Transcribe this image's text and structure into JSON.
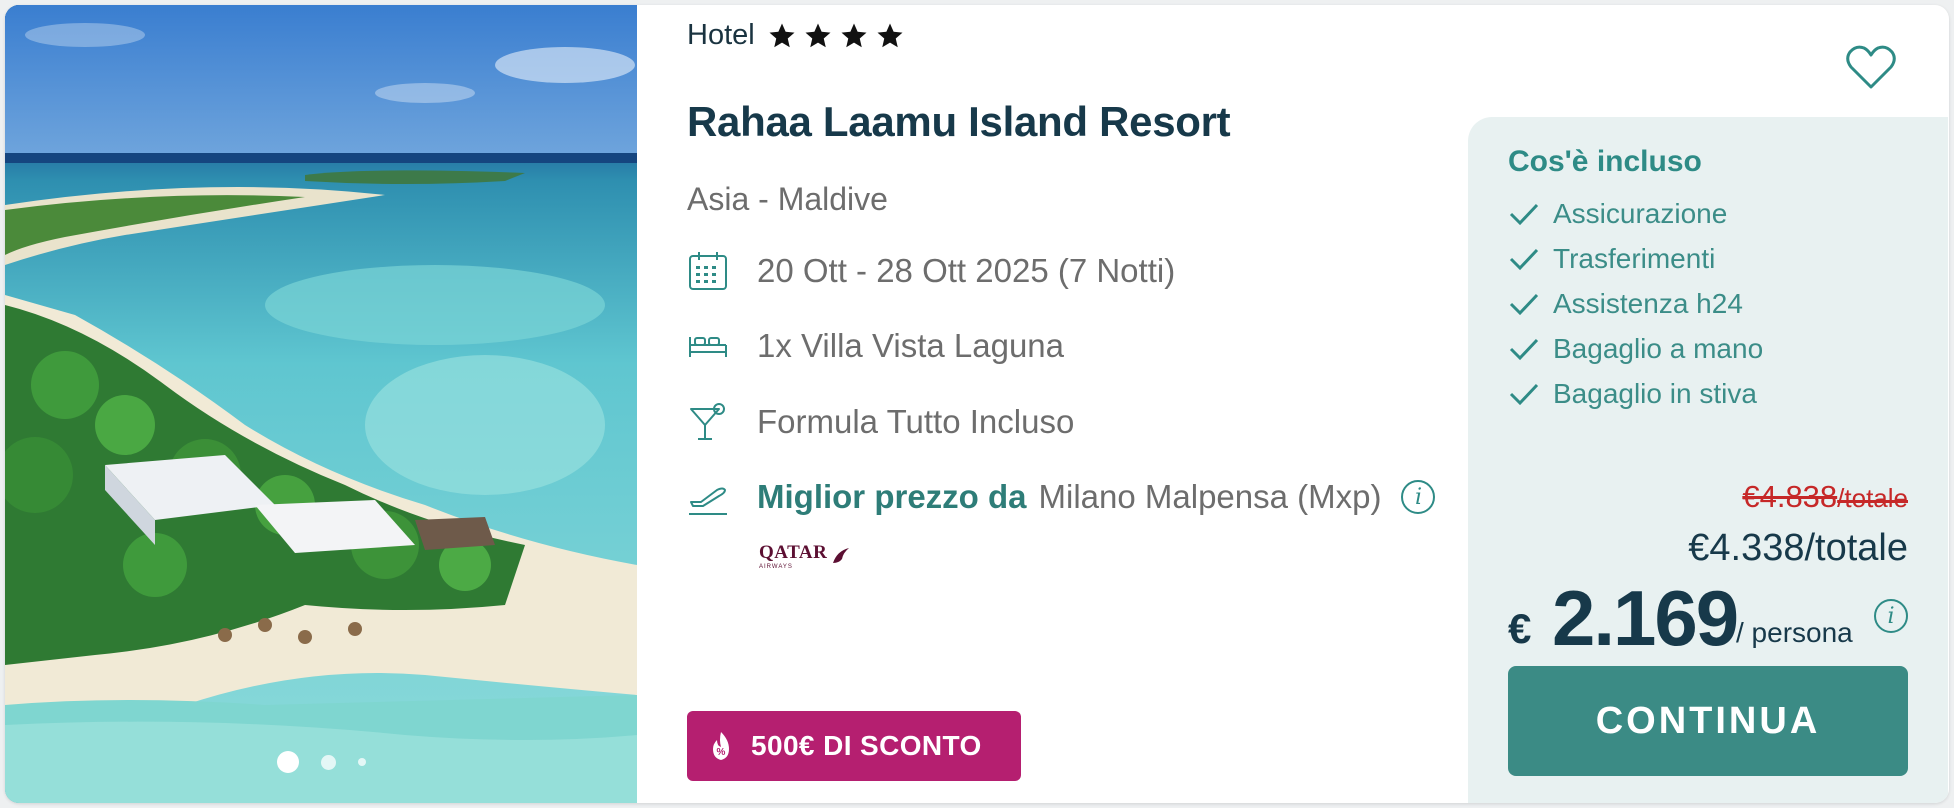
{
  "hotel": {
    "category_label": "Hotel",
    "stars": 4,
    "name": "Rahaa Laamu Island Resort",
    "location": "Asia - Maldive",
    "favorite_icon": "heart-outline-icon"
  },
  "gallery": {
    "slide_count": 3,
    "active_slide": 1
  },
  "features": {
    "dates": "20 Ott - 28 Ott 2025 (7 Notti)",
    "room": "1x Villa Vista Laguna",
    "board": "Formula Tutto Incluso",
    "flight_label": "Miglior prezzo da",
    "flight_origin": "Milano Malpensa (Mxp)",
    "airline": "QATAR",
    "airline_sub": "AIRWAYS"
  },
  "promo": {
    "label": "500€ DI SCONTO",
    "icon": "discount-flame-icon"
  },
  "included": {
    "title": "Cos'è incluso",
    "items": [
      "Assicurazione",
      "Trasferimenti",
      "Assistenza h24",
      "Bagaglio a mano",
      "Bagaglio in stiva"
    ]
  },
  "pricing": {
    "old_total": "€4.838",
    "old_total_unit": "/totale",
    "total": "€4.338/totale",
    "currency": "€",
    "per_person": "2.169",
    "per_person_unit": "/ persona",
    "cta": "CONTINUA"
  },
  "colors": {
    "brand_teal": "#3b8b85",
    "promo_magenta": "#b51f70",
    "old_price_red": "#c62828",
    "navy_text": "#17394a",
    "panel_bg": "#e8f1f1"
  }
}
